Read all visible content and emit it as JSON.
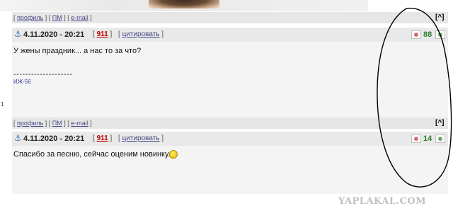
{
  "post1": {
    "links": {
      "profile": "профиль",
      "pm": "ПМ",
      "email": "e-mail"
    },
    "up": "[^]",
    "date": "4.11.2020 - 20:21",
    "number": "911",
    "quote": "цитировать",
    "score": "88",
    "text": "У жены праздник... а нас то за что?",
    "signature_line": "--------------------",
    "signature_link": "ИЖ-56"
  },
  "margin_number": "1",
  "post2": {
    "links": {
      "profile": "профиль",
      "pm": "ПМ",
      "email": "e-mail"
    },
    "up": "[^]",
    "date": "4.11.2020 - 20:21",
    "number": "911",
    "quote": "цитировать",
    "score": "14",
    "text": "Спасибо за песню, сейчас оценим новинку."
  },
  "watermark": "YAPLAKAL.COM",
  "colors": {
    "score": "#2f7d2f",
    "number": "#c00000",
    "link": "#4a4a8a"
  },
  "icons": {
    "anchor": "anchor-icon",
    "vote_down": "vote-down-icon",
    "vote_up": "vote-up-icon",
    "smiley": "smiley-icon"
  }
}
